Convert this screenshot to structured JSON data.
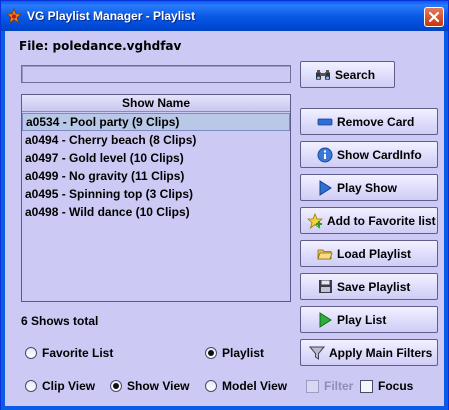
{
  "window": {
    "title": "VG Playlist Manager - Playlist"
  },
  "file": {
    "label": "File: poledance.vghdfav"
  },
  "search": {
    "value": "",
    "button_label": "Search"
  },
  "list": {
    "header": "Show Name",
    "selected_index": 0,
    "items": [
      "a0534 - Pool party (9 Clips)",
      "a0494 - Cherry beach (8 Clips)",
      "a0497 - Gold level (10 Clips)",
      "a0499 - No gravity (11 Clips)",
      "a0495 - Spinning top (3 Clips)",
      "a0498 - Wild dance (10 Clips)"
    ],
    "total_label": "6 Shows total"
  },
  "actions": {
    "remove_card": "Remove Card",
    "show_cardinfo": "Show CardInfo",
    "play_show": "Play Show",
    "add_to_favorite": "Add to Favorite list",
    "load_playlist": "Load Playlist",
    "save_playlist": "Save Playlist",
    "play_list": "Play List",
    "apply_main_filters": "Apply Main Filters"
  },
  "source": {
    "favorite_list": "Favorite List",
    "playlist": "Playlist",
    "selected": "Playlist"
  },
  "view": {
    "clip_view": "Clip View",
    "show_view": "Show View",
    "model_view": "Model View",
    "selected": "Show View",
    "filter": "Filter",
    "filter_checked": false,
    "filter_enabled": false,
    "focus": "Focus",
    "focus_checked": false
  },
  "colors": {
    "window_bg": "#cccaf4",
    "titlebar": "#0a5ae6",
    "selection": "#b8c8e6"
  }
}
